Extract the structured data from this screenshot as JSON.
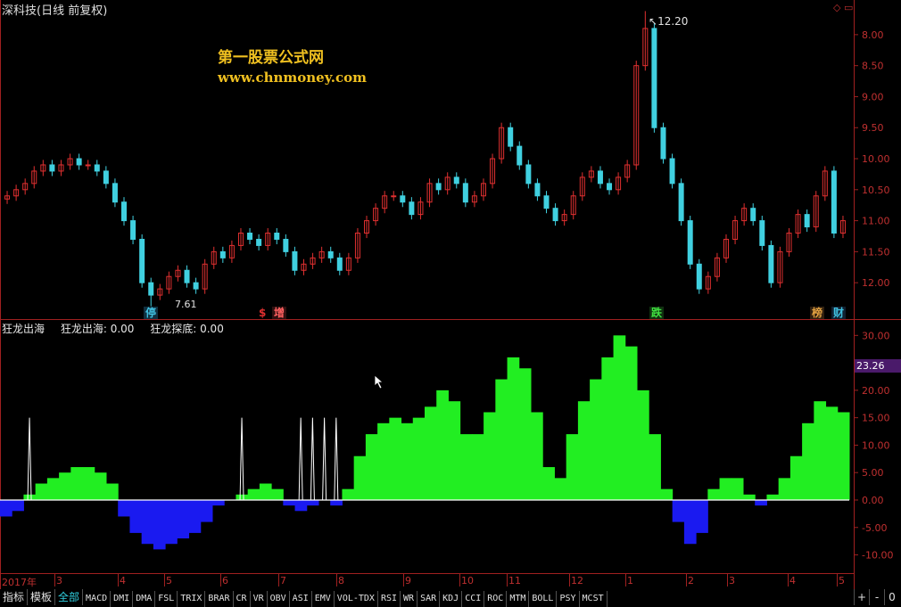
{
  "window": {
    "title": "深科技(日线 前复权)"
  },
  "watermark": {
    "line1": "第一股票公式网",
    "line2": "www.chnmoney.com"
  },
  "price_panel": {
    "y_ticks": [
      "12.00",
      "11.50",
      "11.00",
      "10.50",
      "10.00",
      "9.50",
      "9.00",
      "8.50",
      "8.00"
    ],
    "high_label": "12.20",
    "low_label": "7.61"
  },
  "signals": [
    {
      "text": "停",
      "color": "#40c0e0"
    },
    {
      "text": "$",
      "color": "#e03030"
    },
    {
      "text": "增",
      "color": "#e03030"
    },
    {
      "text": "跌",
      "color": "#40e040"
    },
    {
      "text": "榜",
      "color": "#e0a040"
    },
    {
      "text": "财",
      "color": "#40c0e0"
    }
  ],
  "indicator": {
    "name": "狂龙出海",
    "line1": "狂龙出海: 0.00",
    "line2": "狂龙探底: 0.00",
    "y_ticks": [
      "30.00",
      "25.00",
      "20.00",
      "15.00",
      "10.00",
      "5.00",
      "0.00",
      "-5.00",
      "-10.00"
    ],
    "current_value": "23.26"
  },
  "time_axis": [
    "2017年",
    "3",
    "4",
    "5",
    "6",
    "7",
    "8",
    "9",
    "10",
    "11",
    "12",
    "1",
    "2",
    "3",
    "4",
    "5"
  ],
  "tabs": [
    "指标",
    "模板",
    "全部",
    "MACD",
    "DMI",
    "DMA",
    "FSL",
    "TRIX",
    "BRAR",
    "CR",
    "VR",
    "OBV",
    "ASI",
    "EMV",
    "VOL-TDX",
    "RSI",
    "WR",
    "SAR",
    "KDJ",
    "CCI",
    "ROC",
    "MTM",
    "BOLL",
    "PSY",
    "MCST"
  ],
  "right_buttons": [
    "+",
    "-",
    "0"
  ],
  "chart_data": [
    {
      "type": "candlestick",
      "title": "深科技(日线 前复权)",
      "ylim": [
        7.6,
        12.3
      ],
      "y_ticks": [
        8.0,
        8.5,
        9.0,
        9.5,
        10.0,
        10.5,
        11.0,
        11.5,
        12.0
      ],
      "x_labels": [
        "2017年",
        "3",
        "4",
        "5",
        "6",
        "7",
        "8",
        "9",
        "10",
        "11",
        "12",
        "1",
        "2",
        "3",
        "4",
        "5"
      ],
      "close": [
        9.4,
        9.5,
        9.6,
        9.8,
        9.9,
        9.8,
        9.9,
        10.0,
        9.9,
        9.9,
        9.8,
        9.6,
        9.3,
        9.0,
        8.7,
        8.0,
        7.8,
        7.9,
        8.1,
        8.2,
        8.0,
        7.9,
        8.3,
        8.5,
        8.4,
        8.6,
        8.8,
        8.7,
        8.6,
        8.8,
        8.7,
        8.5,
        8.2,
        8.3,
        8.4,
        8.5,
        8.4,
        8.2,
        8.4,
        8.8,
        9.0,
        9.2,
        9.4,
        9.4,
        9.3,
        9.1,
        9.3,
        9.6,
        9.5,
        9.7,
        9.6,
        9.3,
        9.4,
        9.6,
        10.0,
        10.5,
        10.2,
        9.9,
        9.6,
        9.4,
        9.2,
        9.0,
        9.1,
        9.4,
        9.7,
        9.8,
        9.6,
        9.5,
        9.7,
        9.9,
        11.5,
        12.1,
        10.5,
        10.0,
        9.6,
        9.0,
        8.3,
        7.9,
        8.1,
        8.4,
        8.7,
        9.0,
        9.2,
        9.0,
        8.6,
        8.0,
        8.5,
        8.8,
        9.1,
        8.9,
        9.4,
        9.8,
        8.8,
        9.0
      ],
      "high_label": 12.2,
      "low_label": 7.61
    },
    {
      "type": "area",
      "title": "狂龙出海",
      "ylim": [
        -13,
        32
      ],
      "y_ticks": [
        30,
        25,
        20,
        15,
        10,
        5,
        0,
        -5,
        -10
      ],
      "series": [
        {
          "name": "狂龙出海",
          "values": [
            -3,
            -2,
            1,
            3,
            4,
            5,
            6,
            6,
            5,
            3,
            -3,
            -6,
            -8,
            -9,
            -8,
            -7,
            -6,
            -4,
            -1,
            0,
            1,
            2,
            3,
            2,
            -1,
            -2,
            -1,
            0,
            -1,
            2,
            8,
            12,
            14,
            15,
            14,
            15,
            17,
            20,
            18,
            12,
            12,
            16,
            22,
            26,
            24,
            16,
            6,
            4,
            12,
            18,
            22,
            26,
            30,
            28,
            20,
            12,
            2,
            -4,
            -8,
            -6,
            2,
            4,
            4,
            1,
            -1,
            1,
            4,
            8,
            14,
            18,
            17,
            16
          ]
        },
        {
          "name": "狂龙探底",
          "values": [
            0,
            0,
            15,
            0,
            0,
            0,
            0,
            0,
            0,
            0,
            0,
            0,
            0,
            0,
            0,
            0,
            0,
            0,
            0,
            0,
            15,
            0,
            0,
            0,
            0,
            15,
            15,
            15,
            15,
            0,
            0,
            0,
            0,
            0,
            0,
            0,
            0,
            0,
            0,
            0,
            0,
            0,
            0,
            0,
            0,
            0,
            0,
            0,
            0,
            0,
            0,
            0,
            0,
            0,
            0,
            0,
            0,
            0,
            0,
            0,
            0,
            0,
            0,
            0,
            0,
            0,
            0,
            0,
            0,
            0,
            0,
            0
          ]
        }
      ],
      "current_value": 23.26
    }
  ]
}
